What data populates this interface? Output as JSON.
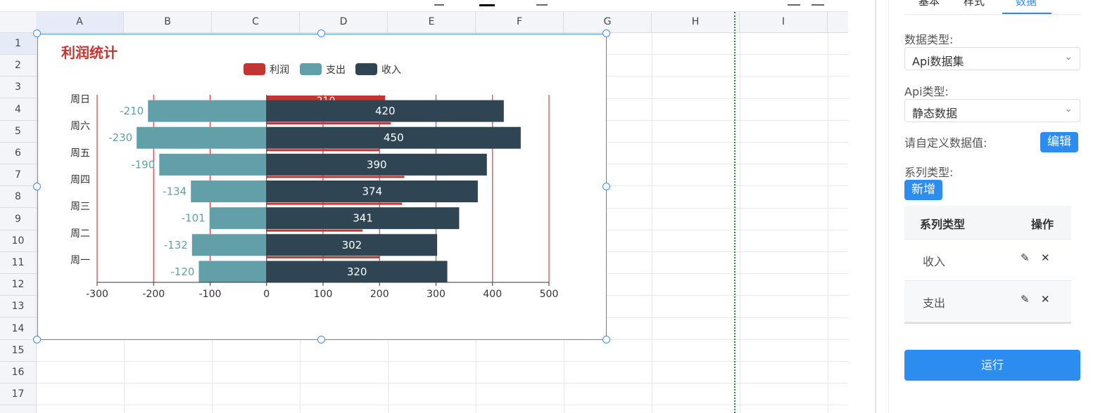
{
  "columns": [
    "A",
    "B",
    "C",
    "D",
    "E",
    "F",
    "G",
    "H",
    "I"
  ],
  "rows": [
    "1",
    "2",
    "3",
    "4",
    "5",
    "6",
    "7",
    "8",
    "9",
    "10",
    "11",
    "12",
    "13",
    "14",
    "15",
    "16",
    "17"
  ],
  "chart_data": {
    "type": "bar",
    "orientation": "horizontal",
    "title": "利润统计",
    "categories": [
      "周一",
      "周二",
      "周三",
      "周四",
      "周五",
      "周六",
      "周日"
    ],
    "series": [
      {
        "name": "利润",
        "values": [
          200,
          170,
          240,
          244,
          200,
          220,
          210
        ],
        "color": "#c23531"
      },
      {
        "name": "支出",
        "values": [
          -120,
          -132,
          -101,
          -134,
          -190,
          -230,
          -210
        ],
        "color": "#61a0a8"
      },
      {
        "name": "收入",
        "values": [
          320,
          302,
          341,
          374,
          390,
          450,
          420
        ],
        "color": "#2f4554"
      }
    ],
    "xlim": [
      -300,
      500
    ],
    "xticks": [
      -300,
      -200,
      -100,
      0,
      100,
      200,
      300,
      400,
      500
    ],
    "legend_position": "top-center",
    "gridlines": true,
    "gridline_color": "#e8373b"
  },
  "panel": {
    "tabs": [
      "基本",
      "样式",
      "数据"
    ],
    "active_tab": "数据",
    "data_type_label": "数据类型:",
    "data_type_value": "Api数据集",
    "api_type_label": "Api类型:",
    "api_type_value": "静态数据",
    "custom_label": "请自定义数据值:",
    "edit_button": "编辑",
    "series_type_label": "系列类型:",
    "add_button": "新增",
    "table_headers": [
      "系列类型",
      "操作"
    ],
    "table_rows": [
      {
        "name": "收入"
      },
      {
        "name": "支出"
      }
    ],
    "run_button": "运行"
  },
  "colors": {
    "accent": "#2d8cf0",
    "selection_border": "#3f8be6",
    "page_break": "#1e8f3a"
  }
}
